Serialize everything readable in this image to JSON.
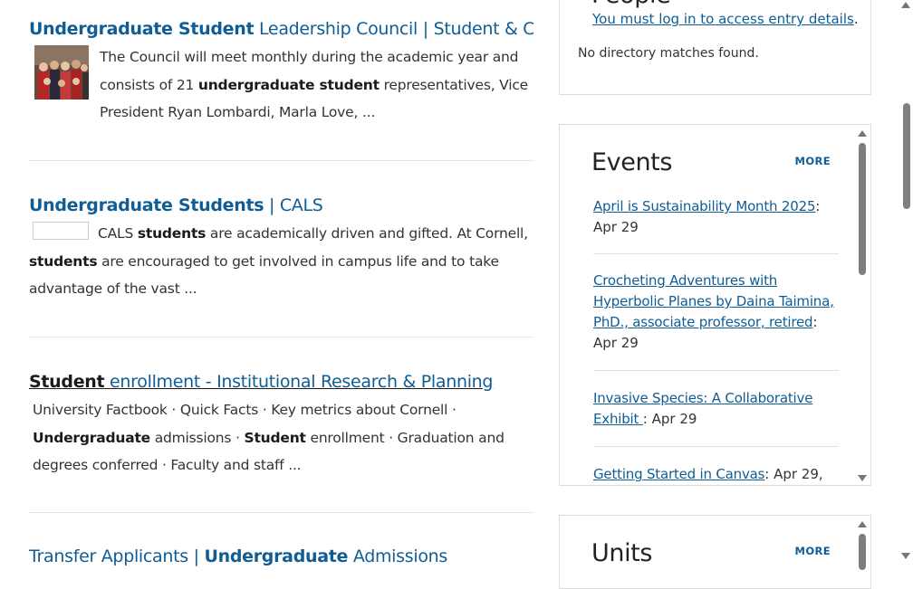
{
  "results": [
    {
      "title_bold": "Undergraduate Student",
      "title_rest": " Leadership Council | Student & Campus ...",
      "snippet_html_parts": [
        {
          "t": "The Council will meet monthly during the academic year and consists of 21 "
        },
        {
          "b": "undergraduate student"
        },
        {
          "t": " representatives, Vice President Ryan Lombardi, Marla Love, ..."
        }
      ]
    },
    {
      "title_bold": "Undergraduate Students",
      "title_rest": " | CALS",
      "snippet_html_parts": [
        {
          "t": "CALS "
        },
        {
          "b": "students"
        },
        {
          "t": " are academically driven and gifted. At Cornell, "
        },
        {
          "b": "students"
        },
        {
          "t": " are encouraged to get involved in campus life and to take advantage of the vast ..."
        }
      ]
    },
    {
      "title_bold": "Student",
      "title_rest": " enrollment - Institutional Research & Planning",
      "snippet_html_parts": [
        {
          "t": "University Factbook · Quick Facts · Key metrics about Cornell · "
        },
        {
          "b": "Undergraduate"
        },
        {
          "t": " admissions · "
        },
        {
          "b": "Student"
        },
        {
          "t": " enrollment · Graduation and degrees conferred · Faculty and staff ..."
        }
      ]
    },
    {
      "title_pre": "Transfer Applicants | ",
      "title_bold": "Undergraduate",
      "title_rest": " Admissions"
    }
  ],
  "people": {
    "heading": "People",
    "login_link": "You must log in to access entry details",
    "no_match": "No directory matches found."
  },
  "events": {
    "heading": "Events",
    "more": "MORE",
    "items": [
      {
        "title": "April is Sustainability Month 2025",
        "date": ": Apr 29"
      },
      {
        "title": "Crocheting Adventures with Hyperbolic Planes by Daina Taimina, PhD., associate professor, retired",
        "date": ": Apr 29"
      },
      {
        "title": "Invasive Species: A Collaborative Exhibit ",
        "date": ": Apr 29"
      },
      {
        "title": "Getting Started in Canvas",
        "date": ": Apr 29,"
      }
    ]
  },
  "units": {
    "heading": "Units",
    "more": "MORE"
  }
}
